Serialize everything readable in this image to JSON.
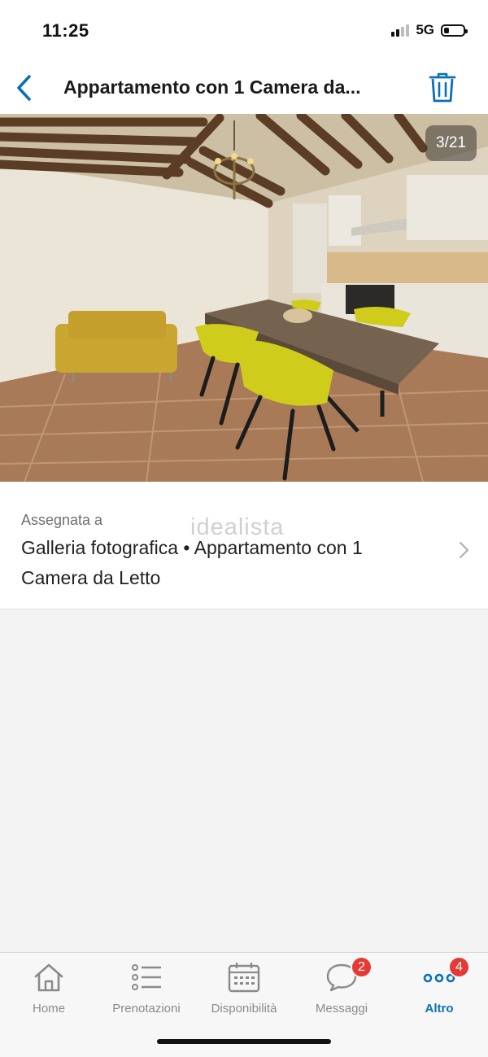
{
  "status_bar": {
    "time": "11:25",
    "network": "5G"
  },
  "nav": {
    "title": "Appartamento con 1 Camera da..."
  },
  "photo": {
    "counter": "3/21"
  },
  "assignment": {
    "label": "Assegnata a",
    "watermark": "idealista",
    "value": "Galleria fotografica • Appartamento con 1 Camera da Letto"
  },
  "tab_bar": {
    "tabs": [
      {
        "label": "Home",
        "icon": "home-icon"
      },
      {
        "label": "Prenotazioni",
        "icon": "list-icon"
      },
      {
        "label": "Disponibilità",
        "icon": "calendar-icon"
      },
      {
        "label": "Messaggi",
        "icon": "chat-bubble-icon",
        "badge": "2"
      },
      {
        "label": "Altro",
        "icon": "more-dots-icon",
        "badge": "4",
        "active": true
      }
    ]
  },
  "colors": {
    "accent": "#0b6fb6",
    "badge": "#e53935"
  }
}
